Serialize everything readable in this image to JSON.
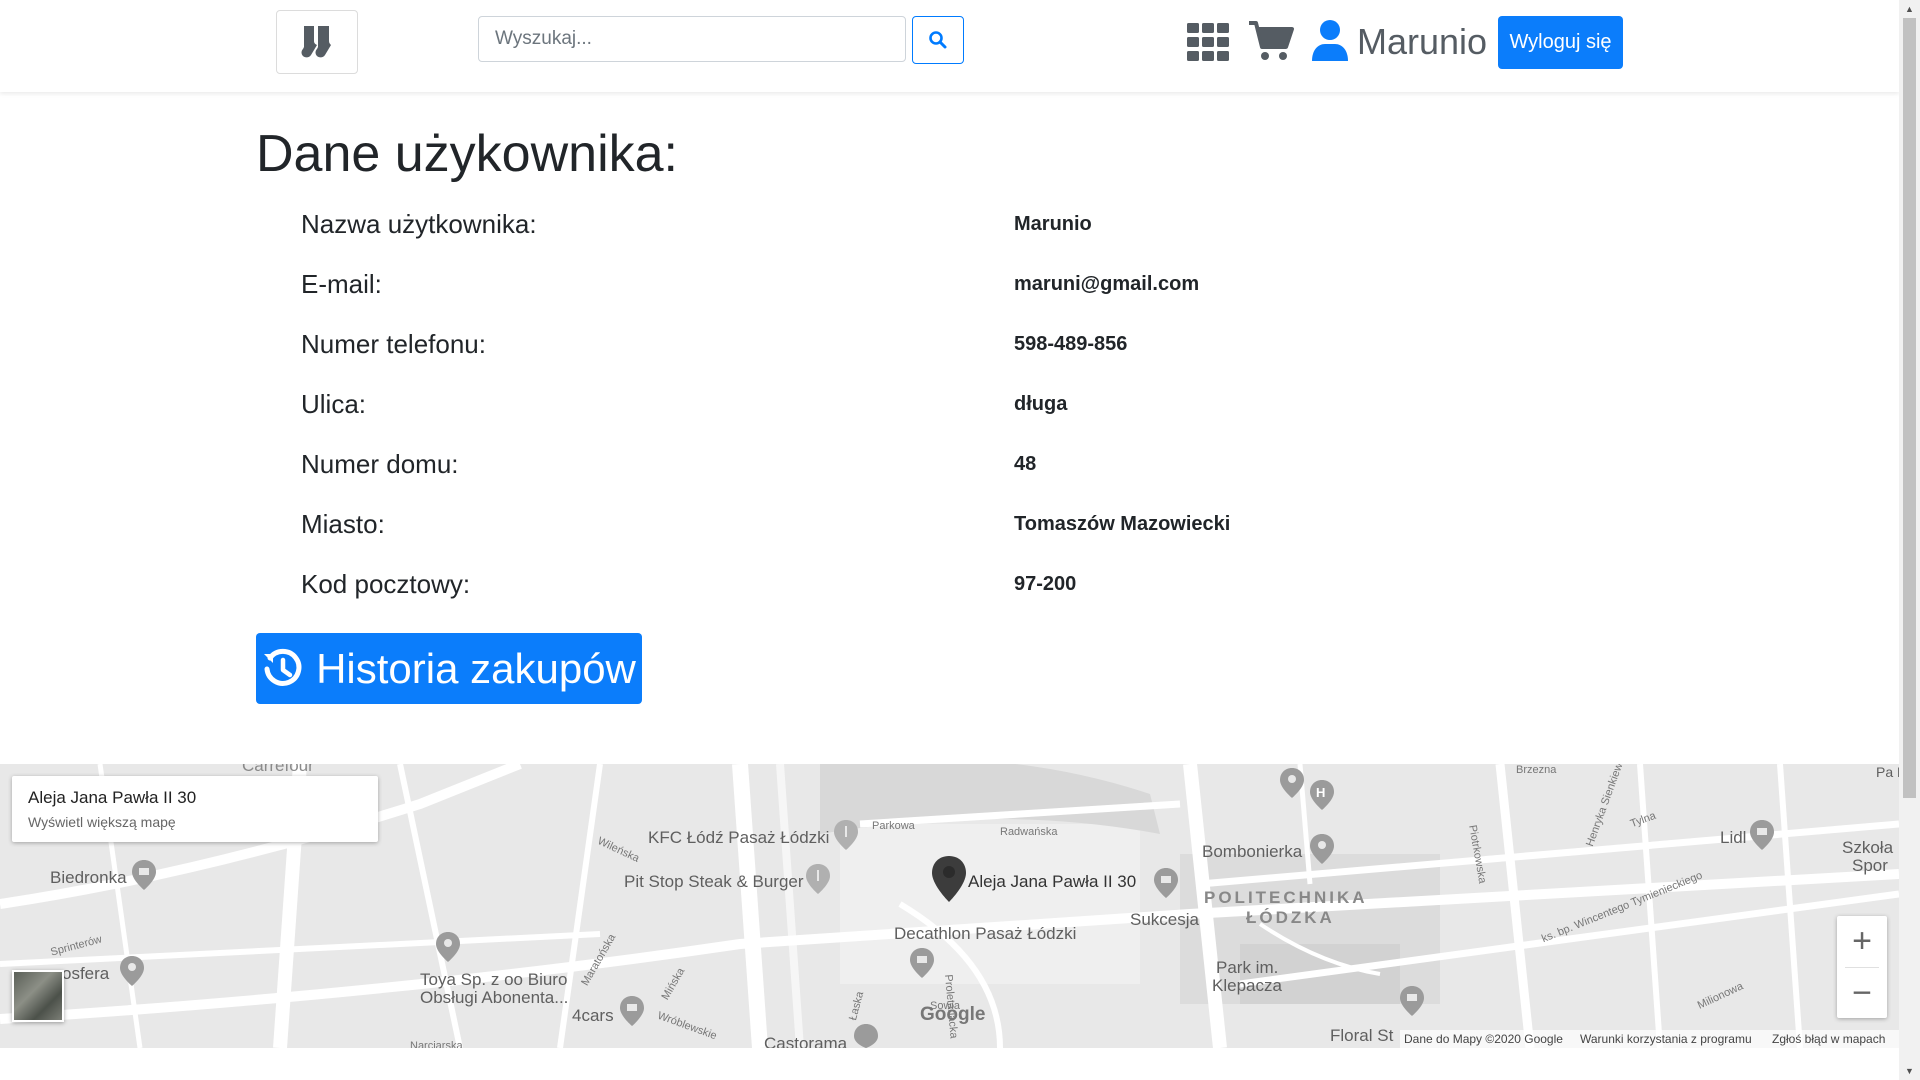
{
  "navbar": {
    "search_placeholder": "Wyszukaj...",
    "username": "Marunio",
    "logout_label": "Wyloguj się"
  },
  "page": {
    "title": "Dane użykownika:",
    "fields": [
      {
        "label": "Nazwa użytkownika:",
        "value": "Marunio"
      },
      {
        "label": "E-mail:",
        "value": "maruni@gmail.com"
      },
      {
        "label": "Numer telefonu:",
        "value": "598-489-856"
      },
      {
        "label": "Ulica:",
        "value": "długa"
      },
      {
        "label": "Numer domu:",
        "value": "48"
      },
      {
        "label": "Miasto:",
        "value": "Tomaszów Mazowiecki"
      },
      {
        "label": "Kod pocztowy:",
        "value": "97-200"
      }
    ],
    "history_button": "Historia zakupów"
  },
  "map": {
    "card_title": "Aleja Jana Pawła II 30",
    "card_link": "Wyświetl większą mapę",
    "labels": {
      "kfc": "KFC Łódź Pasaż Łódzki",
      "pitstop": "Pit Stop Steak & Burger",
      "pin": "Aleja Jana Pawła II 30",
      "decathlon": "Decathlon Pasaż Łódzki",
      "biedronka": "Biedronka",
      "toya1": "Toya Sp. z oo Biuro",
      "toya2": "Obsługi Abonenta...",
      "cars": "4cars",
      "castorama": "Castorama",
      "bombonierka": "Bombonierka",
      "sukcesja": "Sukcesja",
      "polit1": "POLITECHNIKA",
      "polit2": "ŁÓDZKA",
      "park1": "Park im.",
      "park2": "Klepacza",
      "lidl": "Lidl",
      "szkola1": "Szkoła",
      "szkola2": "Spor",
      "floral": "Floral St",
      "apteka": "osfera",
      "carrefour": "Carrefour",
      "parkowa": "Parkowa",
      "radwanska": "Radwańska",
      "piotrkowska": "Piotrkowska",
      "wroblewskiego": "Wróblewskie",
      "maratonska": "Maratońska",
      "wilenska": "Wileńska",
      "sprinterow": "Sprinterów",
      "tylna": "Tylna",
      "milionowa": "Milionowa",
      "brzezna": "Brzezna",
      "wincentego": "ks. bp. Wincentego Tymienieckiego",
      "sienkiewicza": "Henryka Sienkiewicza",
      "narciarska": "Narciarska",
      "glowna": "Pa Kili",
      "proletariacka": "Proletariacka",
      "sowia": "Sowia",
      "laska": "Łaska",
      "minska": "Mińska"
    },
    "google": "Google",
    "footer": {
      "data": "Dane do Mapy ©2020 Google",
      "terms": "Warunki korzystania z programu",
      "report": "Zgłoś błąd w mapach"
    },
    "zoom_in": "+",
    "zoom_out": "−"
  }
}
